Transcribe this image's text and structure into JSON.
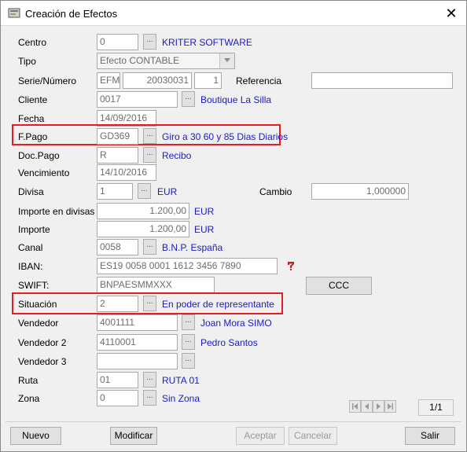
{
  "window": {
    "title": "Creación de Efectos",
    "close": "✕"
  },
  "form": {
    "centro": {
      "label": "Centro",
      "value": "0",
      "link": "KRITER SOFTWARE"
    },
    "tipo": {
      "label": "Tipo",
      "value": "Efecto CONTABLE"
    },
    "serie": {
      "label": "Serie/Número",
      "serie": "EFM",
      "numero": "20030031",
      "sub": "1",
      "ref_label": "Referencia",
      "ref_value": ""
    },
    "cliente": {
      "label": "Cliente",
      "value": "0017",
      "link": "Boutique La Silla"
    },
    "fecha": {
      "label": "Fecha",
      "value": "14/09/2016"
    },
    "fpago": {
      "label": "F.Pago",
      "value": "GD369",
      "link": "Giro a 30 60 y 85 Dias Diarios"
    },
    "docpago": {
      "label": "Doc.Pago",
      "value": "R",
      "link": "Recibo"
    },
    "vencimiento": {
      "label": "Vencimiento",
      "value": "14/10/2016"
    },
    "divisa": {
      "label": "Divisa",
      "value": "1",
      "link": "EUR",
      "cambio_label": "Cambio",
      "cambio_value": "1,000000"
    },
    "importe_divisas": {
      "label": "Importe en divisas",
      "value": "1.200,00",
      "unit": "EUR"
    },
    "importe": {
      "label": "Importe",
      "value": "1.200,00",
      "unit": "EUR"
    },
    "canal": {
      "label": "Canal",
      "value": "0058",
      "link": "B.N.P. España"
    },
    "iban": {
      "label": "IBAN:",
      "value": "ES19 0058 0001 1612 3456 7890"
    },
    "swift": {
      "label": "SWIFT:",
      "value": "BNPAESMMXXX",
      "ccc": "CCC"
    },
    "situacion": {
      "label": "Situación",
      "value": "2",
      "link": "En poder de representante"
    },
    "vendedor": {
      "label": "Vendedor",
      "value": "4001111",
      "link": "Joan Mora SIMO"
    },
    "vendedor2": {
      "label": "Vendedor 2",
      "value": "4110001",
      "link": "Pedro Santos"
    },
    "vendedor3": {
      "label": "Vendedor 3",
      "value": ""
    },
    "ruta": {
      "label": "Ruta",
      "value": "01",
      "link": "RUTA 01"
    },
    "zona": {
      "label": "Zona",
      "value": "0",
      "link": "Sin Zona"
    }
  },
  "dots_label": "...",
  "pager": {
    "text": "1/1"
  },
  "buttons": {
    "nuevo": "Nuevo",
    "modificar": "Modificar",
    "aceptar": "Aceptar",
    "cancelar": "Cancelar",
    "salir": "Salir"
  },
  "colors": {
    "link": "#1d1ac8",
    "highlight": "#e21d24"
  }
}
